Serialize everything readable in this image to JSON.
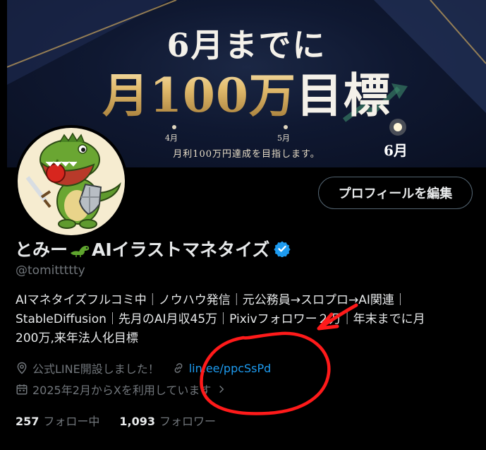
{
  "banner": {
    "headline": "6月までに",
    "title_gold": "月100万",
    "title_white": "目標",
    "timeline": [
      "4月",
      "5月",
      "6月"
    ],
    "subtitle": "月利100万円達成を目指します。"
  },
  "profile": {
    "edit_button": "プロフィールを編集",
    "name_prefix": "とみー",
    "name_suffix": "AIイラストマネタイズ",
    "handle": "@tomittttty",
    "bio_lines": [
      "AIマネタイズフルコミ中｜ノウハウ発信｜元公務員→スロプロ→AI関連｜",
      "StableDiffusion｜先月のAI月収45万｜Pixivフォロワー２万｜年末までに月",
      "200万,来年法人化目標"
    ],
    "location": "公式LINE開設しました！",
    "website": "lin.ee/ppcSsPd",
    "joined": "2025年2月からXを利用しています",
    "following_count": "257",
    "following_label": "フォロー中",
    "followers_count": "1,093",
    "followers_label": "フォロワー"
  },
  "colors": {
    "link": "#1d9bf0",
    "verified": "#1d9bf0",
    "annotation": "#ff1a1a",
    "gold": "#d8b46a"
  },
  "icons": [
    "location-icon",
    "link-icon",
    "calendar-icon",
    "verified-badge-icon",
    "chevron-right-icon",
    "dinosaur-emoji-icon"
  ]
}
